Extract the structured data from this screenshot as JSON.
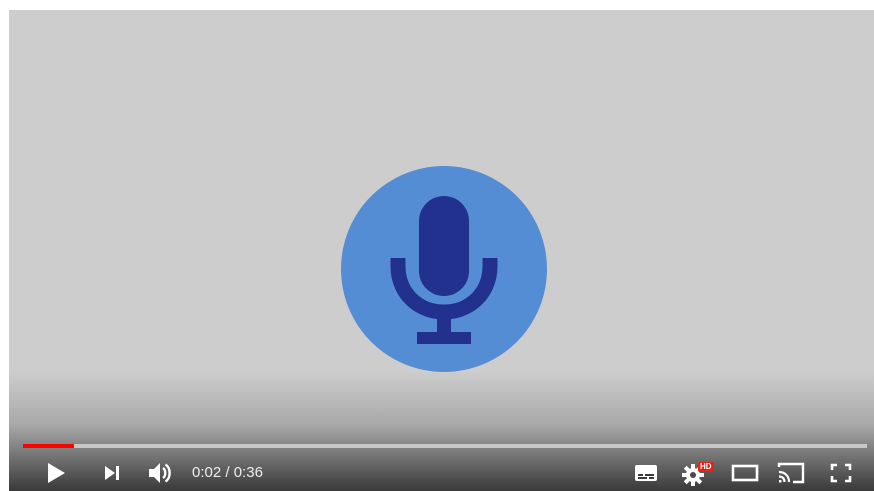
{
  "player": {
    "progress_fraction": 0.06,
    "time": {
      "current": "0:02",
      "separator": " / ",
      "duration": "0:36"
    },
    "hd_badge": "HD",
    "colors": {
      "background": "#cdcdcd",
      "mic_circle": "#548dd4",
      "mic_glyph": "#23318e",
      "progress_played": "#ff0000",
      "hd_badge": "#e62117"
    },
    "controls": [
      {
        "name": "play-button",
        "icon": "play-icon"
      },
      {
        "name": "next-button",
        "icon": "skip-next-icon"
      },
      {
        "name": "volume-button",
        "icon": "volume-icon"
      },
      {
        "name": "subtitles-button",
        "icon": "subtitles-icon"
      },
      {
        "name": "settings-button",
        "icon": "gear-icon"
      },
      {
        "name": "theater-mode-button",
        "icon": "theater-icon"
      },
      {
        "name": "cast-button",
        "icon": "cast-icon"
      },
      {
        "name": "fullscreen-button",
        "icon": "fullscreen-icon"
      }
    ],
    "video_content_icon": "microphone-icon"
  }
}
